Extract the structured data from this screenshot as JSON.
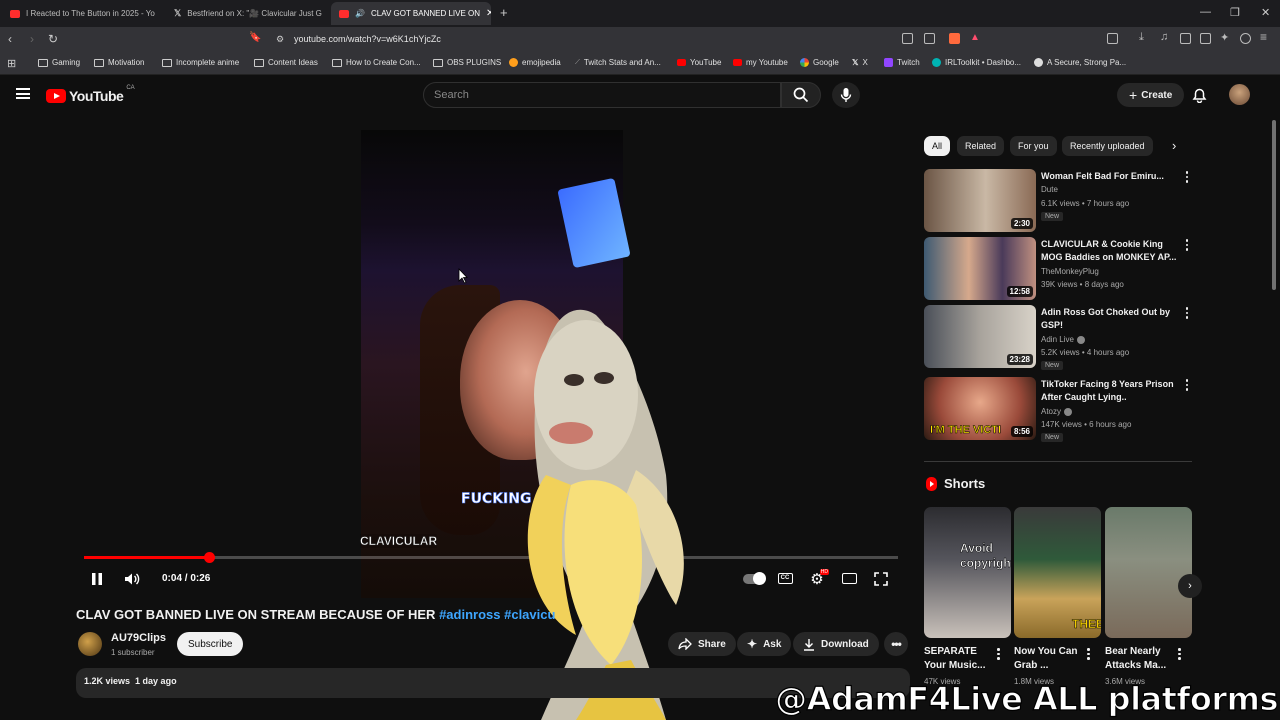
{
  "browser": {
    "tabs": [
      {
        "label": "I Reacted to The Button in 2025 - Yo",
        "fav_color": "#ff2d2d"
      },
      {
        "label": "Bestfriend on X: \"🎥 Clavicular Just G",
        "fav_color": "#ffffff"
      },
      {
        "label": "CLAV GOT BANNED LIVE ON",
        "fav_color": "#ff2d2d"
      }
    ],
    "new_tab": "+",
    "url": "youtube.com/watch?v=w6K1chYjcZc",
    "bookmarks": [
      {
        "label": "Gaming",
        "icon": "folder-icon"
      },
      {
        "label": "Motivation",
        "icon": "folder-icon"
      },
      {
        "label": "Incomplete anime",
        "icon": "folder-icon"
      },
      {
        "label": "Content Ideas",
        "icon": "folder-icon"
      },
      {
        "label": "How to Create Con...",
        "icon": "folder-icon"
      },
      {
        "label": "OBS PLUGINS",
        "icon": "folder-icon"
      },
      {
        "label": "emojipedia",
        "icon": "emojipedia-icon"
      },
      {
        "label": "Twitch Stats and An...",
        "icon": "stats-icon"
      },
      {
        "label": "YouTube",
        "icon": "youtube-icon"
      },
      {
        "label": "my Youtube",
        "icon": "youtube-icon"
      },
      {
        "label": "Google",
        "icon": "google-icon"
      },
      {
        "label": "X",
        "icon": "x-icon"
      },
      {
        "label": "Twitch",
        "icon": "twitch-icon"
      },
      {
        "label": "IRLToolkit • Dashbo...",
        "icon": "irltoolkit-icon"
      },
      {
        "label": "A Secure, Strong Pa...",
        "icon": "info-icon"
      }
    ]
  },
  "header": {
    "logo": "YouTube",
    "country": "CA",
    "search_placeholder": "Search",
    "create_label": "Create"
  },
  "player": {
    "time": "0:04 / 0:26",
    "progress": 0.154,
    "caption_word": "FUCKING",
    "caption_name": "CLAVICULAR"
  },
  "video": {
    "title": "CLAV GOT BANNED LIVE ON STREAM BECAUSE OF HER",
    "tags": "#adinross #clavicu",
    "channel": "AU79Clips",
    "subscribers": "1 subscriber",
    "subscribe_label": "Subscribe",
    "actions": {
      "share": "Share",
      "ask": "Ask",
      "download": "Download"
    },
    "views": "1.2K views",
    "age": "1 day ago"
  },
  "sidebar": {
    "chips": [
      "All",
      "Related",
      "For you",
      "Recently uploaded"
    ],
    "recommendations": [
      {
        "title": "Woman Felt Bad For Emiru...",
        "channel": "Dute",
        "meta": "6.1K views • 7 hours ago",
        "badge": "New",
        "duration": "2:30",
        "verified": false
      },
      {
        "title": "CLAVICULAR & Cookie King MOG Baddies on MONKEY AP...",
        "channel": "TheMonkeyPlug",
        "meta": "39K views • 8 days ago",
        "badge": "",
        "duration": "12:58",
        "verified": false
      },
      {
        "title": "Adin Ross Got Choked Out by GSP!",
        "channel": "Adin Live",
        "meta": "5.2K views • 4 hours ago",
        "badge": "New",
        "duration": "23:28",
        "verified": true
      },
      {
        "title": "TikToker Facing 8 Years Prison After Caught Lying..",
        "channel": "Atozy",
        "meta": "147K views • 6 hours ago",
        "badge": "New",
        "duration": "8:56",
        "verified": true,
        "thumb_text": "I'M THE VICTI"
      }
    ],
    "shorts_heading": "Shorts",
    "shorts": [
      {
        "title": "SEPARATE Your Music...",
        "views": "47K views",
        "thumb_text": "Avoid copyright"
      },
      {
        "title": "Now You Can Grab ...",
        "views": "1.8M views",
        "thumb_text": "THEE"
      },
      {
        "title": "Bear Nearly Attacks Ma...",
        "views": "3.6M views",
        "thumb_text": ""
      }
    ]
  },
  "overlay": {
    "watermark": "@AdamF4Live ALL platforms"
  }
}
